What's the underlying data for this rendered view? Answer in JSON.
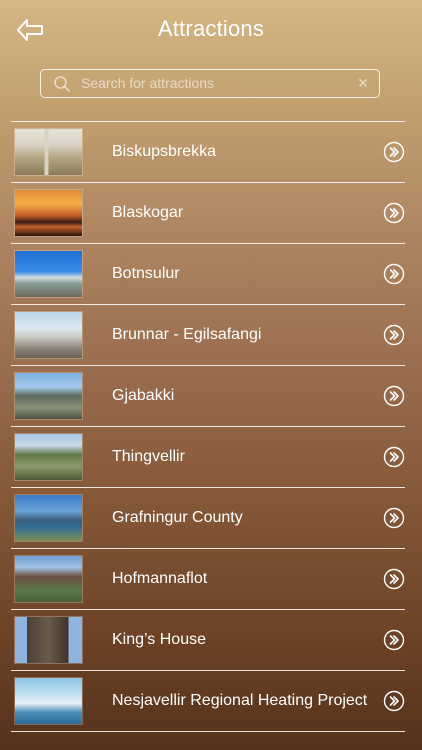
{
  "header": {
    "title": "Attractions"
  },
  "search": {
    "placeholder": "Search for attractions",
    "value": ""
  },
  "attractions": [
    {
      "label": "Biskupsbrekka"
    },
    {
      "label": "Blaskogar"
    },
    {
      "label": "Botnsulur"
    },
    {
      "label": "Brunnar - Egilsafangi"
    },
    {
      "label": "Gjabakki"
    },
    {
      "label": "Thingvellir"
    },
    {
      "label": "Grafningur County"
    },
    {
      "label": "Hofmannaflot"
    },
    {
      "label": "King’s House"
    },
    {
      "label": "Nesjavellir Regional Heating Project"
    }
  ],
  "icons": {
    "back": "back-arrow-icon",
    "search": "search-icon",
    "clear": "clear-icon",
    "row_action": "double-chevron-right-icon"
  },
  "colors": {
    "text": "#ffffff",
    "gradient_top": "#d4b784",
    "gradient_bottom": "#55321b"
  }
}
